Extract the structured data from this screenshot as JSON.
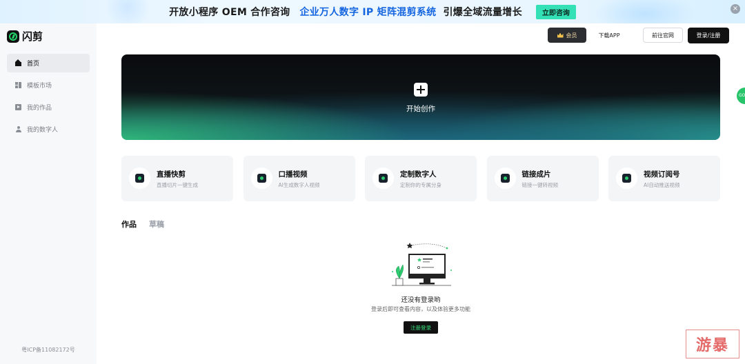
{
  "banner": {
    "text_1": "开放小程序 OEM 合作咨询",
    "text_2": "企业万人数字 IP 矩阵混剪系统",
    "text_3": "引爆全域流量增长",
    "cta": "立即咨询",
    "close": "×"
  },
  "app": {
    "name": "闪剪"
  },
  "sidebar": {
    "items": [
      {
        "label": "首页",
        "icon": "home-icon"
      },
      {
        "label": "模板市场",
        "icon": "grid-icon"
      },
      {
        "label": "我的作品",
        "icon": "works-icon"
      },
      {
        "label": "我的数字人",
        "icon": "person-icon"
      }
    ],
    "icp": "粤ICP备11082172号"
  },
  "header": {
    "vip": "会员",
    "download": "下载APP",
    "website": "前往官网",
    "login": "登录/注册"
  },
  "hero": {
    "label": "开始创作"
  },
  "cards": [
    {
      "title": "直播快剪",
      "subtitle": "直播切片一键生成"
    },
    {
      "title": "口播视频",
      "subtitle": "AI生成数字人视频"
    },
    {
      "title": "定制数字人",
      "subtitle": "定制你的专属分身"
    },
    {
      "title": "链接成片",
      "subtitle": "链接一键转视频"
    },
    {
      "title": "视频订阅号",
      "subtitle": "AI自动推送视频"
    }
  ],
  "tabs": [
    {
      "label": "作品"
    },
    {
      "label": "草稿"
    }
  ],
  "empty": {
    "title": "还没有登录哟",
    "subtitle": "登录后即可查看内容，以及体验更多功能",
    "button": "注册登录"
  },
  "float": {
    "label": "GO"
  },
  "watermark": {
    "text": "游暴"
  },
  "colors": {
    "accent": "#22d36b",
    "banner_cta": "#34e0b5",
    "link_blue": "#1565e0"
  }
}
